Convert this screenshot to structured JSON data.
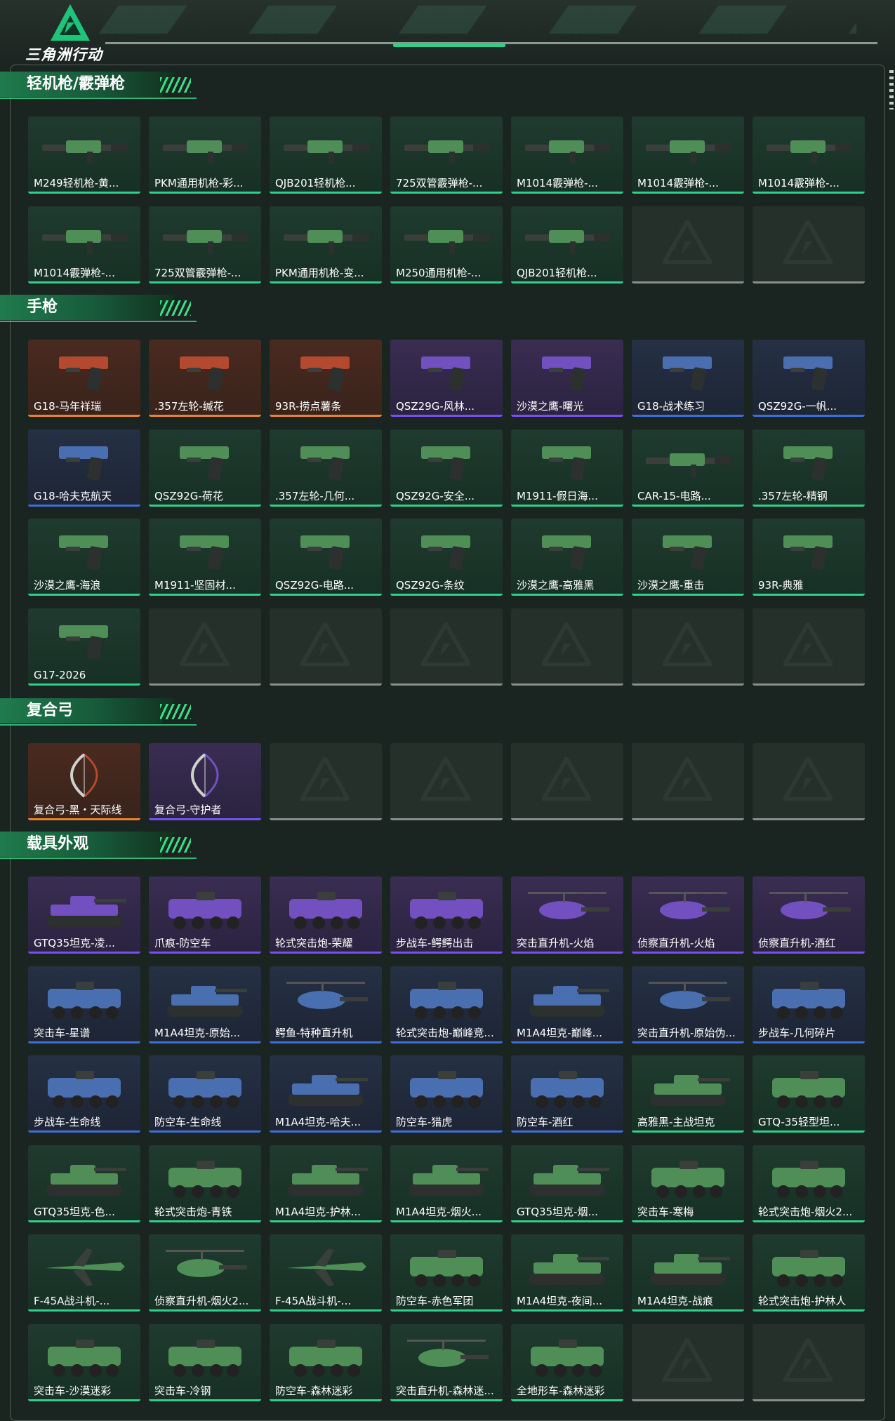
{
  "header": {
    "app_title": "三角洲行动"
  },
  "colors": {
    "green": "#2fd089",
    "purple": "#7a4ff0",
    "orange": "#e8842c",
    "blue": "#3d6fd8",
    "empty": "#8a8f8c"
  },
  "sections": [
    {
      "title": "轻机枪/霰弹枪",
      "items": [
        {
          "name": "M249轻机枪-黄...",
          "rarity": "green"
        },
        {
          "name": "PKM通用机枪-彩...",
          "rarity": "green"
        },
        {
          "name": "QJB201轻机枪...",
          "rarity": "green"
        },
        {
          "name": "725双管霰弹枪-...",
          "rarity": "green"
        },
        {
          "name": "M1014霰弹枪-...",
          "rarity": "green"
        },
        {
          "name": "M1014霰弹枪-...",
          "rarity": "green"
        },
        {
          "name": "M1014霰弹枪-...",
          "rarity": "green"
        },
        {
          "name": "M1014霰弹枪-...",
          "rarity": "green"
        },
        {
          "name": "725双管霰弹枪-...",
          "rarity": "green"
        },
        {
          "name": "PKM通用机枪-变...",
          "rarity": "green"
        },
        {
          "name": "M250通用机枪-...",
          "rarity": "green"
        },
        {
          "name": "QJB201轻机枪...",
          "rarity": "green"
        },
        {
          "name": "",
          "rarity": "empty"
        },
        {
          "name": "",
          "rarity": "empty"
        }
      ]
    },
    {
      "title": "手枪",
      "items": [
        {
          "name": "G18-马年祥瑞",
          "rarity": "orange"
        },
        {
          "name": ".357左轮-缄花",
          "rarity": "orange"
        },
        {
          "name": "93R-捞点薯条",
          "rarity": "orange"
        },
        {
          "name": "QSZ29G-风林...",
          "rarity": "purple"
        },
        {
          "name": "沙漠之鹰-曙光",
          "rarity": "purple"
        },
        {
          "name": "G18-战术练习",
          "rarity": "blue"
        },
        {
          "name": "QSZ92G-一帆...",
          "rarity": "blue"
        },
        {
          "name": "G18-哈夫克航天",
          "rarity": "blue"
        },
        {
          "name": "QSZ92G-荷花",
          "rarity": "green"
        },
        {
          "name": ".357左轮-几何...",
          "rarity": "green"
        },
        {
          "name": "QSZ92G-安全...",
          "rarity": "green"
        },
        {
          "name": "M1911-假日海...",
          "rarity": "green"
        },
        {
          "name": "CAR-15-电路...",
          "rarity": "green"
        },
        {
          "name": ".357左轮-精钢",
          "rarity": "green"
        },
        {
          "name": "沙漠之鹰-海浪",
          "rarity": "green"
        },
        {
          "name": "M1911-坚固材...",
          "rarity": "green"
        },
        {
          "name": "QSZ92G-电路...",
          "rarity": "green"
        },
        {
          "name": "QSZ92G-条纹",
          "rarity": "green"
        },
        {
          "name": "沙漠之鹰-高雅黑",
          "rarity": "green"
        },
        {
          "name": "沙漠之鹰-重击",
          "rarity": "green"
        },
        {
          "name": "93R-典雅",
          "rarity": "green"
        },
        {
          "name": "G17-2026",
          "rarity": "green"
        },
        {
          "name": "",
          "rarity": "empty"
        },
        {
          "name": "",
          "rarity": "empty"
        },
        {
          "name": "",
          "rarity": "empty"
        },
        {
          "name": "",
          "rarity": "empty"
        },
        {
          "name": "",
          "rarity": "empty"
        },
        {
          "name": "",
          "rarity": "empty"
        }
      ]
    },
    {
      "title": "复合弓",
      "items": [
        {
          "name": "复合弓-黑・天际线",
          "rarity": "orange"
        },
        {
          "name": "复合弓-守护者",
          "rarity": "purple"
        },
        {
          "name": "",
          "rarity": "empty"
        },
        {
          "name": "",
          "rarity": "empty"
        },
        {
          "name": "",
          "rarity": "empty"
        },
        {
          "name": "",
          "rarity": "empty"
        },
        {
          "name": "",
          "rarity": "empty"
        }
      ]
    },
    {
      "title": "载具外观",
      "items": [
        {
          "name": "GTQ35坦克-凌...",
          "rarity": "purple"
        },
        {
          "name": "爪痕-防空车",
          "rarity": "purple"
        },
        {
          "name": "轮式突击炮-荣耀",
          "rarity": "purple"
        },
        {
          "name": "步战车-鳄鳄出击",
          "rarity": "purple"
        },
        {
          "name": "突击直升机-火焰",
          "rarity": "purple"
        },
        {
          "name": "侦察直升机-火焰",
          "rarity": "purple"
        },
        {
          "name": "侦察直升机-酒红",
          "rarity": "purple"
        },
        {
          "name": "突击车-星谱",
          "rarity": "blue"
        },
        {
          "name": "M1A4坦克-原始...",
          "rarity": "blue"
        },
        {
          "name": "鳄鱼-特种直升机",
          "rarity": "blue"
        },
        {
          "name": "轮式突击炮-巅峰竞...",
          "rarity": "blue"
        },
        {
          "name": "M1A4坦克-巅峰...",
          "rarity": "blue"
        },
        {
          "name": "突击直升机-原始伪...",
          "rarity": "blue"
        },
        {
          "name": "步战车-几何碎片",
          "rarity": "blue"
        },
        {
          "name": "步战车-生命线",
          "rarity": "blue"
        },
        {
          "name": "防空车-生命线",
          "rarity": "blue"
        },
        {
          "name": "M1A4坦克-哈夫...",
          "rarity": "blue"
        },
        {
          "name": "防空车-猎虎",
          "rarity": "blue"
        },
        {
          "name": "防空车-酒红",
          "rarity": "blue"
        },
        {
          "name": "高雅黑-主战坦克",
          "rarity": "green"
        },
        {
          "name": "GTQ-35轻型坦...",
          "rarity": "green"
        },
        {
          "name": "GTQ35坦克-色...",
          "rarity": "green"
        },
        {
          "name": "轮式突击炮-青铁",
          "rarity": "green"
        },
        {
          "name": "M1A4坦克-护林...",
          "rarity": "green"
        },
        {
          "name": "M1A4坦克-烟火...",
          "rarity": "green"
        },
        {
          "name": "GTQ35坦克-烟...",
          "rarity": "green"
        },
        {
          "name": "突击车-寒梅",
          "rarity": "green"
        },
        {
          "name": "轮式突击炮-烟火2...",
          "rarity": "green"
        },
        {
          "name": "F-45A战斗机-...",
          "rarity": "green"
        },
        {
          "name": "侦察直升机-烟火2...",
          "rarity": "green"
        },
        {
          "name": "F-45A战斗机-...",
          "rarity": "green"
        },
        {
          "name": "防空车-赤色军团",
          "rarity": "green"
        },
        {
          "name": "M1A4坦克-夜间...",
          "rarity": "green"
        },
        {
          "name": "M1A4坦克-战痕",
          "rarity": "green"
        },
        {
          "name": "轮式突击炮-护林人",
          "rarity": "green"
        },
        {
          "name": "突击车-沙漠迷彩",
          "rarity": "green"
        },
        {
          "name": "突击车-冷钢",
          "rarity": "green"
        },
        {
          "name": "防空车-森林迷彩",
          "rarity": "green"
        },
        {
          "name": "突击直升机-森林迷...",
          "rarity": "green"
        },
        {
          "name": "全地形车-森林迷彩",
          "rarity": "green"
        },
        {
          "name": "",
          "rarity": "empty"
        },
        {
          "name": "",
          "rarity": "empty"
        }
      ]
    }
  ]
}
